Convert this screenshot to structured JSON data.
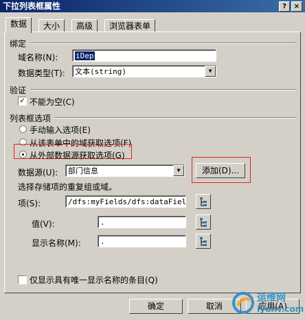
{
  "window": {
    "title": "下拉列表框属性",
    "help_btn": "?",
    "close_btn": "×"
  },
  "tabs": [
    "数据",
    "大小",
    "高级",
    "浏览器表单"
  ],
  "binding": {
    "group_label": "绑定",
    "field_name_label": "域名称(N):",
    "field_name_value": "iDep",
    "data_type_label": "数据类型(T):",
    "data_type_value": "文本(string)"
  },
  "validation": {
    "group_label": "验证",
    "not_empty_label": "不能为空(C)",
    "not_empty_checked": true
  },
  "list_options": {
    "group_label": "列表框选项",
    "options": [
      {
        "label": "手动输入选项(E)",
        "selected": false
      },
      {
        "label": "从该表单中的域获取选项(F)",
        "selected": false
      },
      {
        "label": "从外部数据源获取选项(G)",
        "selected": true
      }
    ],
    "data_source_label": "数据源(U):",
    "data_source_value": "部门信息",
    "add_button": "添加(D)...",
    "hint": "选择存储项的重复组或域。",
    "entries_label": "项(S):",
    "entries_value": "/dfs:myFields/dfs:dataFields/",
    "value_label": "值(V):",
    "value_value": ".",
    "display_name_label": "显示名称(M):",
    "display_name_value": ".",
    "unique_only_label": "仅显示具有唯一显示名称的条目(Q)",
    "unique_only_checked": false
  },
  "footer": {
    "ok": "确定",
    "cancel": "取消",
    "apply": "应用(A)"
  },
  "watermark": {
    "line1": "运维网",
    "line2": "iyunv.com"
  }
}
